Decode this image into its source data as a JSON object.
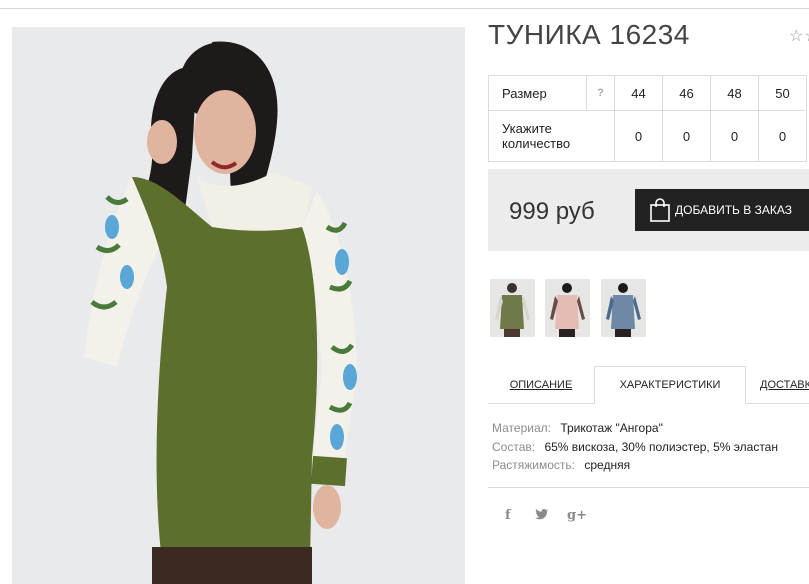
{
  "product": {
    "title": "ТУНИКА 16234",
    "stars": "☆☆",
    "photo_alt": "tunic-model-photo"
  },
  "sizes": {
    "size_label": "Размер",
    "help": "?",
    "qty_label_line1": "Укажите",
    "qty_label_line2": "количество",
    "values": [
      "44",
      "46",
      "48",
      "50"
    ],
    "quantities": [
      "0",
      "0",
      "0",
      "0"
    ]
  },
  "purchase": {
    "price": "999 руб",
    "add_button": "ДОБАВИТЬ В ЗАКАЗ",
    "button_icon": "shopping-bag-icon"
  },
  "thumbnails": [
    "green-tunic-thumbnail",
    "pink-tunic-thumbnail",
    "blue-tunic-thumbnail"
  ],
  "tabs": {
    "description": "ОПИСАНИЕ",
    "characteristics": "ХАРАКТЕРИСТИКИ",
    "delivery": "ДОСТАВКА"
  },
  "characteristics": {
    "material_key": "Материал:",
    "material_val": "Трикотаж \"Ангора\"",
    "composition_key": "Состав:",
    "composition_val": "65% вискоза, 30% полиэстер, 5% эластан",
    "stretch_key": "Растяжимость:",
    "stretch_val": "средняя"
  },
  "social": {
    "facebook": "f",
    "twitter": "t",
    "googleplus": "g+"
  },
  "colors": {
    "tunic_green": "#5d6f2d",
    "button_dark": "#222222",
    "panel_gray": "#ececec",
    "sleeve_blue": "#5aa6d6"
  }
}
